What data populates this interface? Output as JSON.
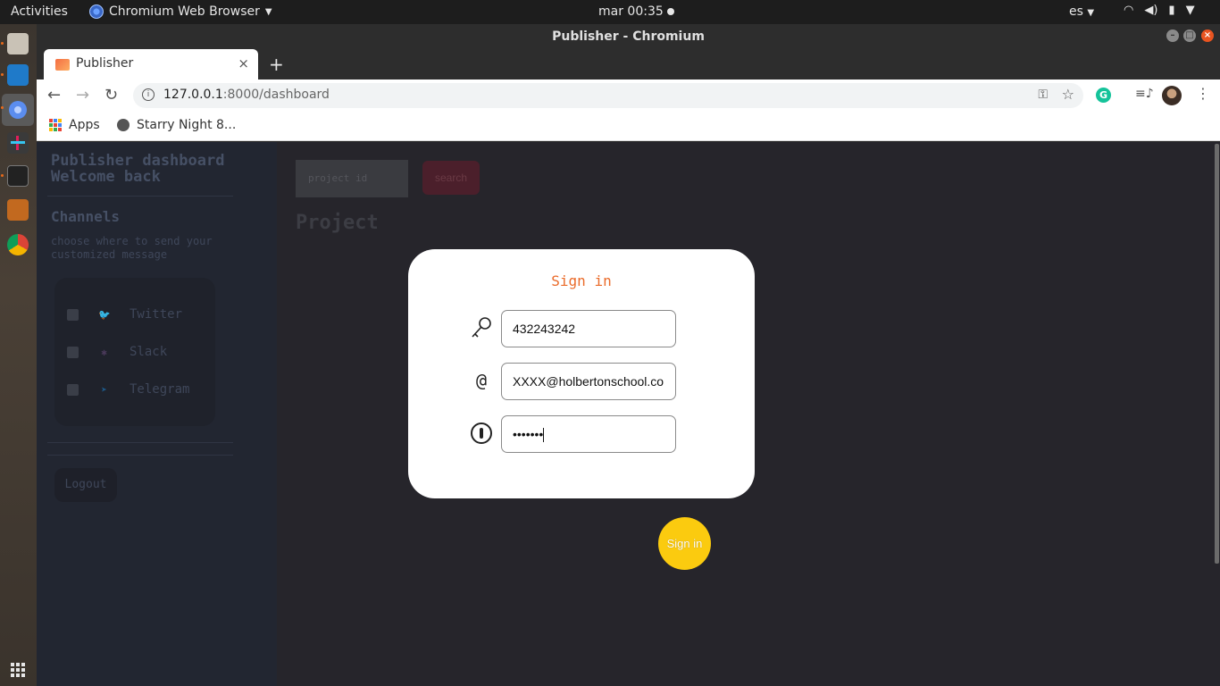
{
  "topbar": {
    "activities": "Activities",
    "app_name": "Chromium Web Browser",
    "clock": "mar 00:35",
    "lang": "es"
  },
  "window": {
    "title": "Publisher - Chromium"
  },
  "tab": {
    "label": "Publisher",
    "close": "×",
    "new_tab": "+"
  },
  "toolbar": {
    "url_host": "127.0.0.1",
    "url_rest": ":8000/dashboard",
    "extension_letter": "G"
  },
  "bookmarks": {
    "apps": "Apps",
    "starry": "Starry Night 8..."
  },
  "sidebar": {
    "title_line1": "Publisher dashboard",
    "title_line2": "Welcome back",
    "channels_heading": "Channels",
    "channels_desc": "choose where to send your customized message",
    "channels": [
      {
        "label": "Twitter",
        "icon": "twitter-icon",
        "color": "#1d5a8a"
      },
      {
        "label": "Slack",
        "icon": "slack-icon",
        "color": "#4a3a5a"
      },
      {
        "label": "Telegram",
        "icon": "telegram-icon",
        "color": "#1d5a8a"
      }
    ],
    "logout": "Logout"
  },
  "main": {
    "search_placeholder": "project id",
    "search_button": "search",
    "project_heading": "Project"
  },
  "modal": {
    "title": "Sign in",
    "project_id_value": "432243242",
    "email_value": "XXXX@holbertonschool.co",
    "password_value": "•••••••",
    "submit": "Sign in"
  },
  "colors": {
    "accent_orange": "#ea6b2a",
    "signin_yellow": "#fbcb0f",
    "page_bg": "#26252b",
    "sidebar_bg": "#222631"
  }
}
